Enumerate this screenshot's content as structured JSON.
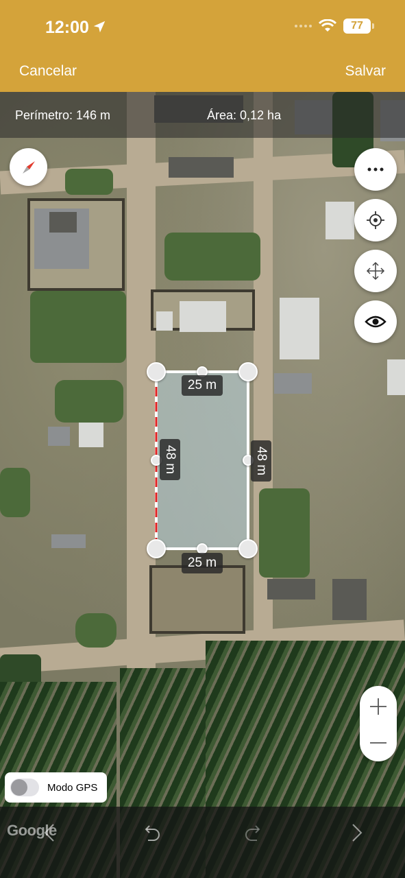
{
  "status_bar": {
    "time": "12:00",
    "battery": "77"
  },
  "nav": {
    "cancel": "Cancelar",
    "save": "Salvar"
  },
  "measurement": {
    "perimeter": "Perímetro: 146 m",
    "area": "Área: 0,12 ha"
  },
  "edges": {
    "top": "25 m",
    "bottom": "25 m",
    "left": "48 m",
    "right": "48 m"
  },
  "gps": {
    "label": "Modo GPS",
    "enabled": false
  },
  "attribution": "Google",
  "colors": {
    "accent": "#d4a33a",
    "selected_edge": "#e02020",
    "plot_fill": "rgba(190,215,225,0.55)"
  },
  "icons": [
    "compass-icon",
    "more-icon",
    "locate-icon",
    "move-icon",
    "eye-icon",
    "plus-icon",
    "minus-icon",
    "chevron-left-icon",
    "undo-icon",
    "redo-icon",
    "chevron-right-icon",
    "location-arrow-icon",
    "wifi-icon"
  ]
}
